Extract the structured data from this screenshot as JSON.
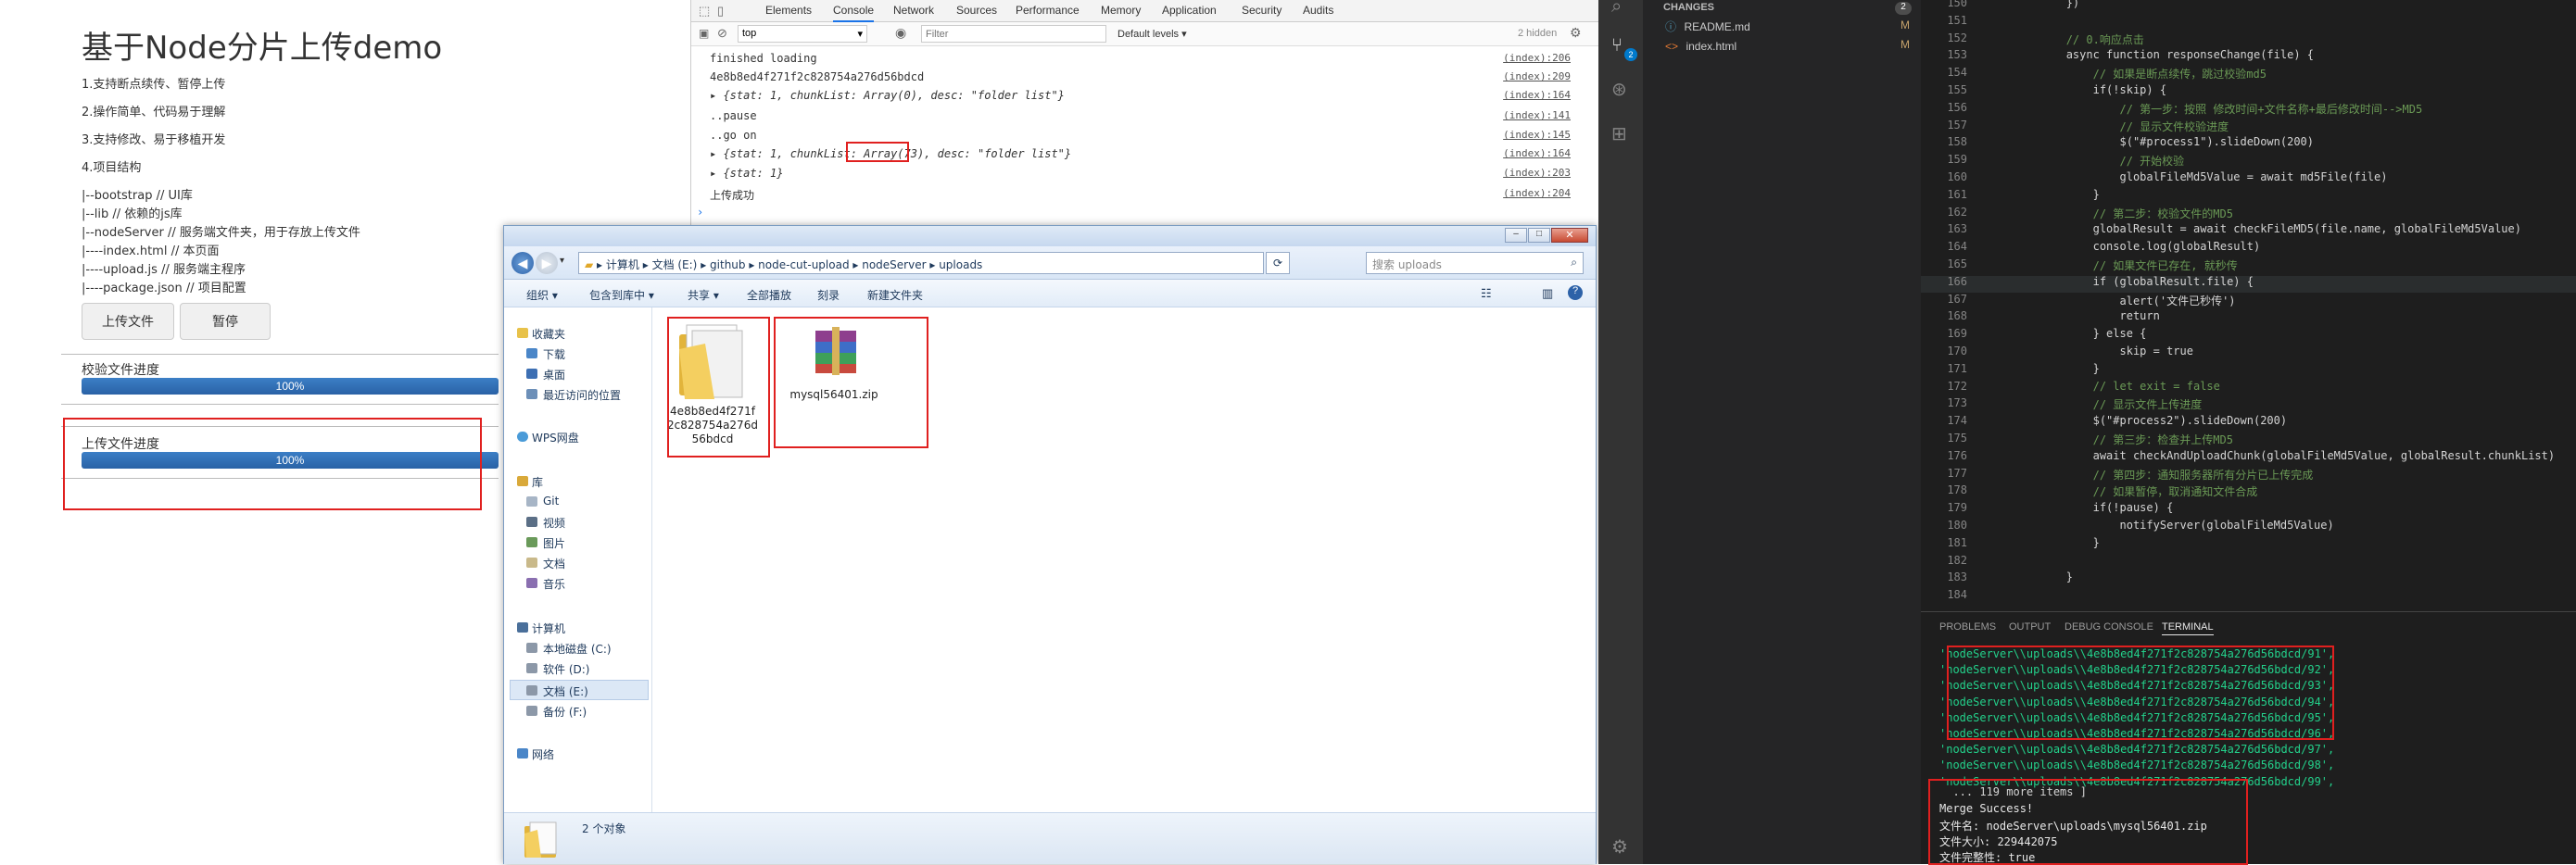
{
  "demo": {
    "title": "基于Node分片上传demo",
    "features": [
      "1.支持断点续传、暂停上传",
      "2.操作简单、代码易于理解",
      "3.支持修改、易于移植开发",
      "4.项目结构"
    ],
    "tree": [
      "|--bootstrap // UI库",
      "|--lib // 依赖的js库",
      "|--nodeServer // 服务端文件夹，用于存放上传文件",
      "|----index.html // 本页面",
      "|----upload.js // 服务端主程序",
      "|----package.json // 项目配置"
    ],
    "upload_button": "上传文件",
    "pause_button": "暂停",
    "verify_label": "校验文件进度",
    "verify_progress": "100%",
    "verify_progress_value": 100,
    "upload_label": "上传文件进度",
    "upload_progress": "100%",
    "upload_progress_value": 100
  },
  "devtools": {
    "tabs": [
      "Elements",
      "Console",
      "Network",
      "Sources",
      "Performance",
      "Memory",
      "Application",
      "Security",
      "Audits"
    ],
    "context": "top",
    "filter_placeholder": "Filter",
    "levels": "Default levels ▾",
    "hidden": "2 hidden",
    "lines": [
      {
        "text": "finished loading",
        "src": "(index):206"
      },
      {
        "text": "4e8b8ed4f271f2c828754a276d56bdcd",
        "src": "(index):209"
      },
      {
        "text": "▸ {stat: 1, chunkList: Array(0), desc: \"folder list\"}",
        "src": "(index):164"
      },
      {
        "text": "..pause",
        "src": "(index):141"
      },
      {
        "text": "..go on",
        "src": "(index):145"
      },
      {
        "text": "▸ {stat: 1, chunkList: Array(73), desc: \"folder list\"}",
        "src": "(index):164"
      },
      {
        "text": "▸ {stat: 1}",
        "src": "(index):203"
      },
      {
        "text": "上传成功",
        "src": "(index):204"
      }
    ],
    "prompt": "›"
  },
  "explorer": {
    "breadcrumb": [
      "计算机",
      "文档 (E:)",
      "github",
      "node-cut-upload",
      "nodeServer",
      "uploads"
    ],
    "search_placeholder": "搜索 uploads",
    "commands": [
      "组织 ▾",
      "包含到库中 ▾",
      "共享 ▾",
      "全部播放",
      "刻录",
      "新建文件夹"
    ],
    "nav": [
      "收藏夹",
      "下载",
      "桌面",
      "最近访问的位置",
      "WPS网盘",
      "库",
      "Git",
      "视频",
      "图片",
      "文档",
      "音乐",
      "计算机",
      "本地磁盘 (C:)",
      "软件 (D:)",
      "文档 (E:)",
      "备份 (F:)",
      "网络"
    ],
    "files": [
      {
        "name_line1": "4e8b8ed4f271f",
        "name_line2": "2c828754a276d",
        "name_line3": "56bdcd",
        "type": "folder"
      },
      {
        "name_line1": "mysql56401.zip",
        "type": "zip"
      }
    ],
    "status": "2 个对象"
  },
  "vscode": {
    "sidebar_header": "CHANGES",
    "badge": "2",
    "changes": [
      {
        "name": "README.md",
        "status": "M"
      },
      {
        "name": "index.html",
        "status": "M"
      }
    ],
    "code_lines": [
      {
        "n": "150",
        "t": "            })"
      },
      {
        "n": "151",
        "t": ""
      },
      {
        "n": "152",
        "t": "            // 0.响应点击"
      },
      {
        "n": "153",
        "t": "            async function responseChange(file) {"
      },
      {
        "n": "154",
        "t": "                // 如果是断点续传，跳过校验md5"
      },
      {
        "n": "155",
        "t": "                if(!skip) {"
      },
      {
        "n": "156",
        "t": "                    // 第一步：按照 修改时间+文件名称+最后修改时间-->MD5"
      },
      {
        "n": "157",
        "t": "                    // 显示文件校验进度"
      },
      {
        "n": "158",
        "t": "                    $(\"#process1\").slideDown(200)"
      },
      {
        "n": "159",
        "t": "                    // 开始校验"
      },
      {
        "n": "160",
        "t": "                    globalFileMd5Value = await md5File(file)"
      },
      {
        "n": "161",
        "t": "                }"
      },
      {
        "n": "162",
        "t": "                // 第二步：校验文件的MD5"
      },
      {
        "n": "163",
        "t": "                globalResult = await checkFileMD5(file.name, globalFileMd5Value)"
      },
      {
        "n": "164",
        "t": "                console.log(globalResult)"
      },
      {
        "n": "165",
        "t": "                // 如果文件已存在, 就秒传"
      },
      {
        "n": "166",
        "t": "                if (globalResult.file) {"
      },
      {
        "n": "167",
        "t": "                    alert('文件已秒传')"
      },
      {
        "n": "168",
        "t": "                    return"
      },
      {
        "n": "169",
        "t": "                } else {"
      },
      {
        "n": "170",
        "t": "                    skip = true"
      },
      {
        "n": "171",
        "t": "                }"
      },
      {
        "n": "172",
        "t": "                // let exit = false"
      },
      {
        "n": "173",
        "t": "                // 显示文件上传进度"
      },
      {
        "n": "174",
        "t": "                $(\"#process2\").slideDown(200)"
      },
      {
        "n": "175",
        "t": "                // 第三步：检查并上传MD5"
      },
      {
        "n": "176",
        "t": "                await checkAndUploadChunk(globalFileMd5Value, globalResult.chunkList)"
      },
      {
        "n": "177",
        "t": "                // 第四步：通知服务器所有分片已上传完成"
      },
      {
        "n": "178",
        "t": "                // 如果暂停，取消通知文件合成"
      },
      {
        "n": "179",
        "t": "                if(!pause) {"
      },
      {
        "n": "180",
        "t": "                    notifyServer(globalFileMd5Value)"
      },
      {
        "n": "181",
        "t": "                }"
      },
      {
        "n": "182",
        "t": ""
      },
      {
        "n": "183",
        "t": "            }"
      },
      {
        "n": "184",
        "t": ""
      }
    ],
    "panel_tabs": [
      "PROBLEMS",
      "OUTPUT",
      "DEBUG CONSOLE",
      "TERMINAL"
    ],
    "terminal_paths": [
      "'nodeServer\\\\uploads\\\\4e8b8ed4f271f2c828754a276d56bdcd/91',",
      "'nodeServer\\\\uploads\\\\4e8b8ed4f271f2c828754a276d56bdcd/92',",
      "'nodeServer\\\\uploads\\\\4e8b8ed4f271f2c828754a276d56bdcd/93',",
      "'nodeServer\\\\uploads\\\\4e8b8ed4f271f2c828754a276d56bdcd/94',",
      "'nodeServer\\\\uploads\\\\4e8b8ed4f271f2c828754a276d56bdcd/95',",
      "'nodeServer\\\\uploads\\\\4e8b8ed4f271f2c828754a276d56bdcd/96',",
      "'nodeServer\\\\uploads\\\\4e8b8ed4f271f2c828754a276d56bdcd/97',",
      "'nodeServer\\\\uploads\\\\4e8b8ed4f271f2c828754a276d56bdcd/98',",
      "'nodeServer\\\\uploads\\\\4e8b8ed4f271f2c828754a276d56bdcd/99',"
    ],
    "terminal_more": "  ... 119 more items ]",
    "terminal_result": [
      "Merge Success!",
      "文件名: nodeServer\\uploads\\mysql56401.zip",
      "文件大小: 229442075",
      "文件完整性: true"
    ]
  }
}
